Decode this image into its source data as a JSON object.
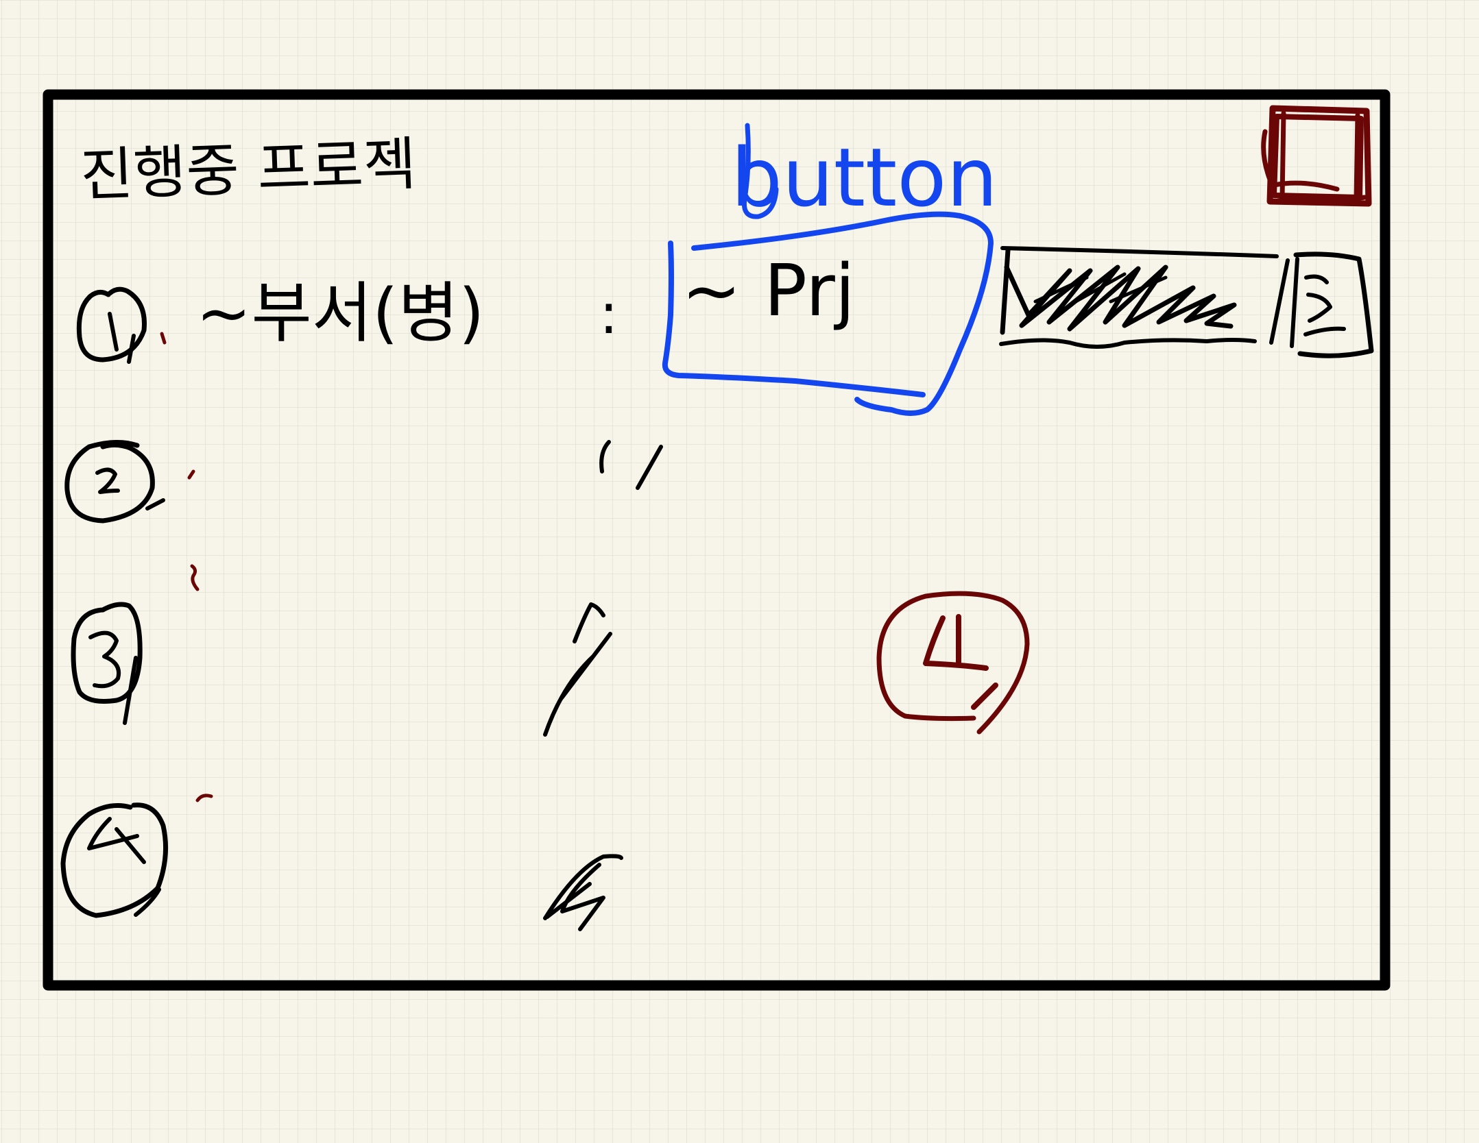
{
  "sketch": {
    "title": "진행중 프로젝",
    "annotation": "button",
    "rows": [
      {
        "number": "①",
        "label": "~부서(병)",
        "separator": ":",
        "cell": "~ Prj"
      },
      {
        "number": "②",
        "separator": "''"
      },
      {
        "number": "③",
        "separator": "\""
      },
      {
        "number": "④",
        "separator": "\""
      }
    ],
    "colors": {
      "paper": "#f7f5ea",
      "grid": "#dcdcd0",
      "ink": "#000000",
      "annotation_ink": "#1446f0",
      "accent_ink": "#6b0606"
    }
  }
}
